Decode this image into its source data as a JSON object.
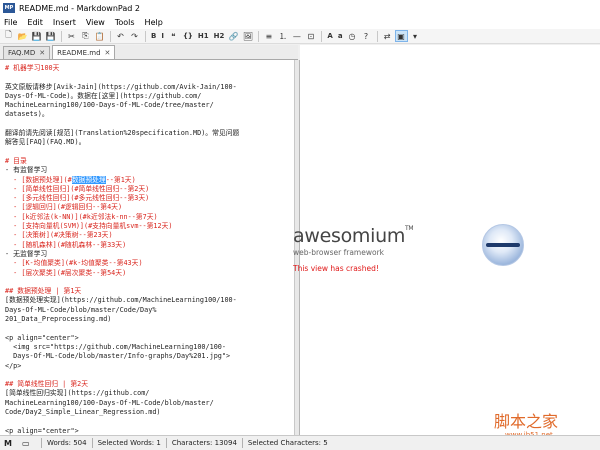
{
  "window": {
    "title": "README.md - MarkdownPad 2",
    "app_icon_text": "MP"
  },
  "menu": [
    "File",
    "Edit",
    "Insert",
    "View",
    "Tools",
    "Help"
  ],
  "toolbar": {
    "buttons": [
      {
        "icon": "new-file-icon",
        "glyph": "🗋"
      },
      {
        "icon": "open-folder-icon",
        "glyph": "📂"
      },
      {
        "icon": "save-icon",
        "glyph": "💾"
      },
      {
        "icon": "save-all-icon",
        "glyph": "💾"
      },
      {
        "icon": "cut-icon",
        "glyph": "✂"
      },
      {
        "icon": "copy-icon",
        "glyph": "⎘"
      },
      {
        "icon": "paste-icon",
        "glyph": "📋"
      },
      {
        "icon": "undo-icon",
        "glyph": "↶"
      },
      {
        "icon": "redo-icon",
        "glyph": "↷"
      },
      {
        "icon": "bold-icon",
        "glyph": "B"
      },
      {
        "icon": "italic-icon",
        "glyph": "I"
      },
      {
        "icon": "quote-icon",
        "glyph": "❝"
      },
      {
        "icon": "code-icon",
        "glyph": "{}"
      },
      {
        "icon": "h1-icon",
        "glyph": "H1"
      },
      {
        "icon": "h2-icon",
        "glyph": "H2"
      },
      {
        "icon": "link-icon",
        "glyph": "🔗"
      },
      {
        "icon": "image-icon",
        "glyph": "🖼"
      },
      {
        "icon": "bullet-list-icon",
        "glyph": "≡"
      },
      {
        "icon": "numbered-list-icon",
        "glyph": "⒈"
      },
      {
        "icon": "hr-icon",
        "glyph": "—"
      },
      {
        "icon": "timestamp-icon",
        "glyph": "⊡"
      },
      {
        "icon": "font-a-icon",
        "glyph": "A"
      },
      {
        "icon": "font-a-small-icon",
        "glyph": "a"
      },
      {
        "icon": "clock-icon",
        "glyph": "◷"
      },
      {
        "icon": "help-icon",
        "glyph": "?"
      },
      {
        "icon": "sync-scroll-icon",
        "glyph": "⇄"
      },
      {
        "icon": "preview-icon",
        "glyph": "▣"
      },
      {
        "icon": "dropdown-icon",
        "glyph": "▾"
      }
    ]
  },
  "tabs": [
    {
      "label": "FAQ.MD",
      "active": false
    },
    {
      "label": "README.md",
      "active": true
    }
  ],
  "editor": {
    "lines": [
      {
        "t": "# 机器学习100天",
        "c": "h"
      },
      {
        "t": "",
        "c": ""
      },
      {
        "t": "英文原版请移步[Avik-Jain](https://github.com/Avik-Jain/100-",
        "c": ""
      },
      {
        "t": "Days-Of-ML-Code)。数据在[这里](https://github.com/",
        "c": ""
      },
      {
        "t": "MachineLearning100/100-Days-Of-ML-Code/tree/master/",
        "c": ""
      },
      {
        "t": "datasets)。",
        "c": ""
      },
      {
        "t": "",
        "c": ""
      },
      {
        "t": "翻译前请先阅读[规范](Translation%20specification.MD)。常见问题",
        "c": ""
      },
      {
        "t": "解答见[FAQ](FAQ.MD)。",
        "c": ""
      },
      {
        "t": "",
        "c": ""
      },
      {
        "t": "# 目录",
        "c": "h"
      },
      {
        "t": "- 有监督学习",
        "c": ""
      },
      {
        "t": "  - [数据预处理](#数据预处理--第1天)",
        "c": "sel"
      },
      {
        "t": "  - [简单线性回归](#简单线性回归--第2天)",
        "c": "link"
      },
      {
        "t": "  - [多元线性回归](#多元线性回归--第3天)",
        "c": "link"
      },
      {
        "t": "  - [逻辑回归](#逻辑回归--第4天)",
        "c": "link"
      },
      {
        "t": "  - [k近邻法(k-NN)](#k近邻法k-nn--第7天)",
        "c": "link"
      },
      {
        "t": "  - [支持向量机(SVM)](#支持向量机svm--第12天)",
        "c": "link"
      },
      {
        "t": "  - [决策树](#决策树--第23天)",
        "c": "link"
      },
      {
        "t": "  - [随机森林](#随机森林--第33天)",
        "c": "link"
      },
      {
        "t": "- 无监督学习",
        "c": ""
      },
      {
        "t": "  - [K-均值聚类](#k-均值聚类--第43天)",
        "c": "link"
      },
      {
        "t": "  - [层次聚类](#层次聚类--第54天)",
        "c": "link"
      },
      {
        "t": "",
        "c": ""
      },
      {
        "t": "## 数据预处理 | 第1天",
        "c": "h"
      },
      {
        "t": "[数据预处理实现](https://github.com/MachineLearning100/100-",
        "c": ""
      },
      {
        "t": "Days-Of-ML-Code/blob/master/Code/Day%",
        "c": ""
      },
      {
        "t": "201_Data_Preprocessing.md)",
        "c": ""
      },
      {
        "t": "",
        "c": ""
      },
      {
        "t": "<p align=\"center\">",
        "c": ""
      },
      {
        "t": "  <img src=\"https://github.com/MachineLearning100/100-",
        "c": ""
      },
      {
        "t": "  Days-Of-ML-Code/blob/master/Info-graphs/Day%201.jpg\">",
        "c": ""
      },
      {
        "t": "</p>",
        "c": ""
      },
      {
        "t": "",
        "c": ""
      },
      {
        "t": "## 简单线性回归 | 第2天",
        "c": "h"
      },
      {
        "t": "[简单线性回归实现](https://github.com/",
        "c": ""
      },
      {
        "t": "MachineLearning100/100-Days-Of-ML-Code/blob/master/",
        "c": ""
      },
      {
        "t": "Code/Day2_Simple_Linear_Regression.md)",
        "c": ""
      },
      {
        "t": "",
        "c": ""
      },
      {
        "t": "<p align=\"center\">",
        "c": ""
      }
    ],
    "selected_text": "数据预处理"
  },
  "preview": {
    "logo_text": "awesomium",
    "logo_tm": "TM",
    "subtitle": "web-browser framework",
    "crash_message": "This view has crashed!"
  },
  "status": {
    "words": "Words: 504",
    "selected_words": "Selected Words: 1",
    "characters": "Characters: 13094",
    "selected_characters": "Selected Characters: 5"
  },
  "watermark": {
    "text": "脚本之家",
    "url": "www.jb51.net"
  }
}
